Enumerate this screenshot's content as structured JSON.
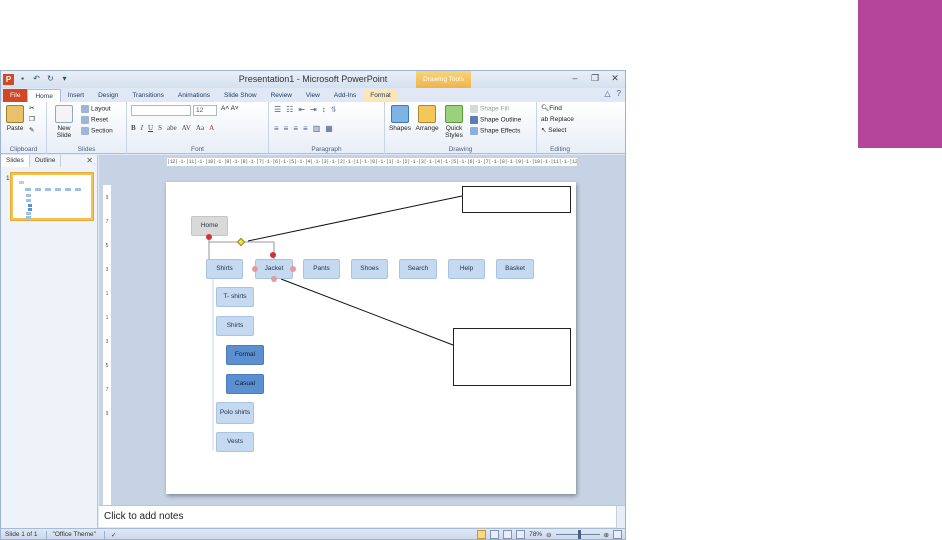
{
  "window": {
    "title": "Presentation1 - Microsoft PowerPoint",
    "contextual_group": "Drawing Tools",
    "app_icon": "P"
  },
  "tabs": [
    "File",
    "Home",
    "Insert",
    "Design",
    "Transitions",
    "Animations",
    "Slide Show",
    "Review",
    "View",
    "Add-Ins",
    "Format"
  ],
  "ribbon": {
    "clipboard": {
      "label": "Clipboard",
      "paste": "Paste"
    },
    "slides": {
      "label": "Slides",
      "new_slide": "New Slide",
      "layout": "Layout",
      "reset": "Reset",
      "section": "Section"
    },
    "font": {
      "label": "Font",
      "size": "12"
    },
    "paragraph": {
      "label": "Paragraph"
    },
    "drawing": {
      "label": "Drawing",
      "shapes": "Shapes",
      "arrange": "Arrange",
      "quick_styles": "Quick Styles",
      "shape_fill": "Shape Fill",
      "shape_outline": "Shape Outline",
      "shape_effects": "Shape Effects"
    },
    "editing": {
      "label": "Editing",
      "find": "Find",
      "replace": "Replace",
      "select": "Select"
    }
  },
  "panel": {
    "tab_slides": "Slides",
    "tab_outline": "Outline",
    "slide_number": "1"
  },
  "ruler": {
    "h": "|12|·1·|11|·1·|10|·1·|9|·1·|8|·1·|7|·1·|6|·1·|5|·1·|4|·1·|3|·1·|2|·1·|1|·1·|0|·1·|1|·1·|2|·1·|3|·1·|4|·1·|5|·1·|6|·1·|7|·1·|8|·1·|9|·1·|10|·1·|11|·1·|12|"
  },
  "sitemap": {
    "home": "Home",
    "top_nav": [
      "Shirts",
      "Jacket",
      "Pants",
      "Shoes",
      "Search",
      "Help",
      "Basket"
    ],
    "sub": [
      "T- shirts",
      "Shirts",
      "Formal",
      "Casual",
      "Polo shirts",
      "Vests"
    ]
  },
  "notes": {
    "placeholder": "Click to add notes"
  },
  "status": {
    "slide": "Slide 1 of 1",
    "theme": "\"Office Theme\"",
    "zoom": "78%"
  },
  "colors": {
    "accent_block": "#b5459a",
    "file_tab": "#d24726",
    "node_fill": "#c5daf0",
    "node_dark": "#5b8fd0"
  }
}
